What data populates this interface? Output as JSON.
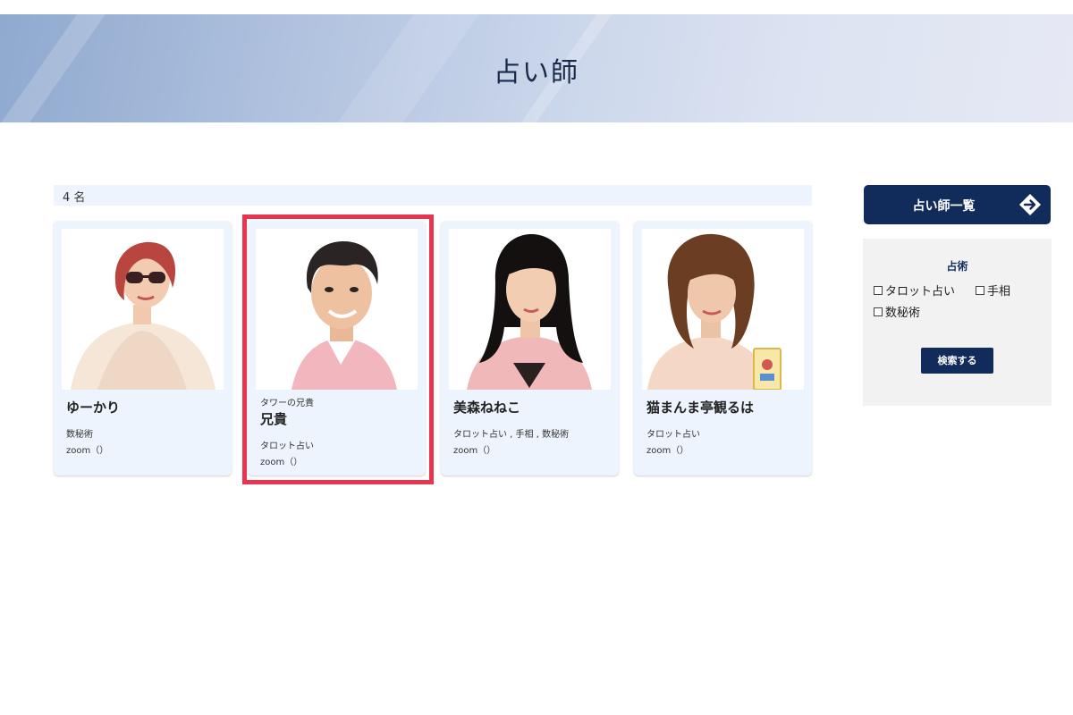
{
  "header": {
    "title": "占い師"
  },
  "results": {
    "count_label": "4 名"
  },
  "cards": [
    {
      "subtitle": "",
      "name": "ゆーかり",
      "methods": "数秘術",
      "zoom": "zoom（）"
    },
    {
      "subtitle": "タワーの兄貴",
      "name": "兄貴",
      "methods": "タロット占い",
      "zoom": "zoom（）"
    },
    {
      "subtitle": "",
      "name": "美森ねねこ",
      "methods": "タロット占い , 手相 , 数秘術",
      "zoom": "zoom（）"
    },
    {
      "subtitle": "",
      "name": "猫まんま亭観るは",
      "methods": "タロット占い",
      "zoom": "zoom（）"
    }
  ],
  "sidebar": {
    "list_button_label": "占い師一覧",
    "filter": {
      "title": "占術",
      "options": [
        "タロット占い",
        "手相",
        "数秘術"
      ],
      "search_label": "検索する"
    }
  },
  "colors": {
    "navy": "#112c5a",
    "card_bg": "#edf4fd",
    "highlight": "#e8344e"
  },
  "icons": {
    "list_button": "arrow-right-circle-icon",
    "checkbox": "checkbox-icon"
  }
}
